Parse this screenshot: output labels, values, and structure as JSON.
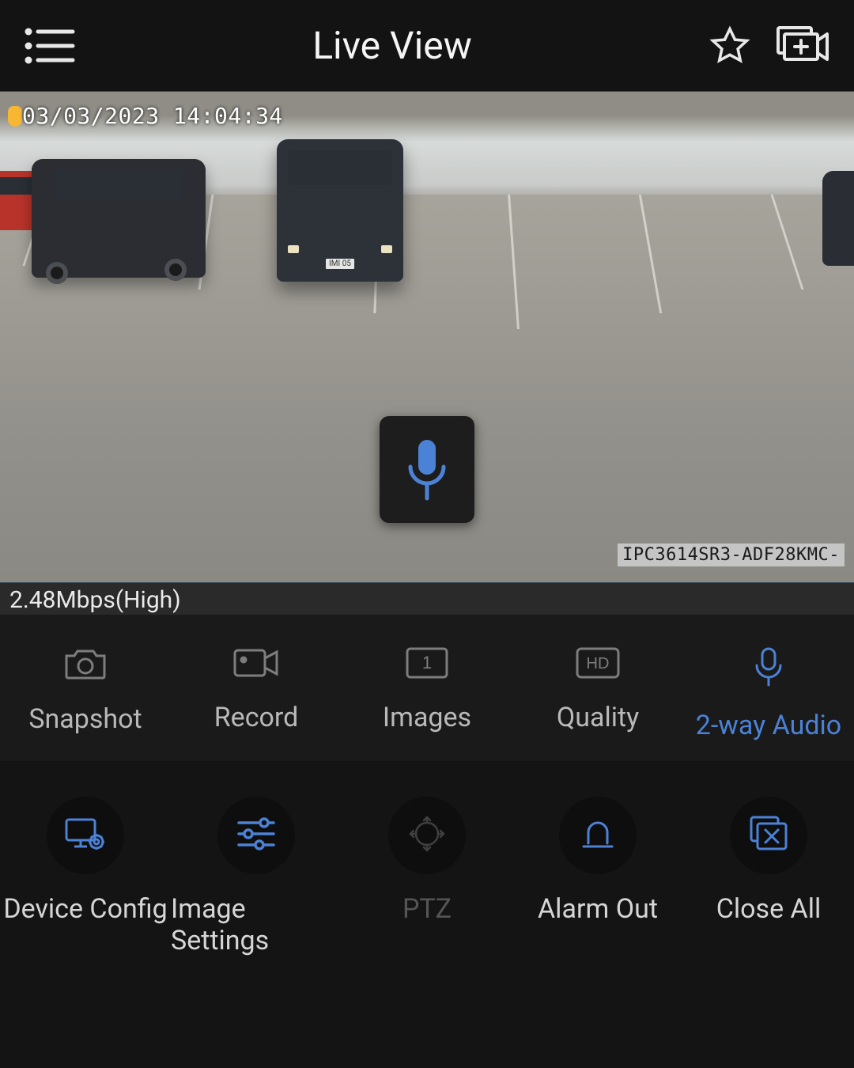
{
  "header": {
    "title": "Live View"
  },
  "video": {
    "timestamp": "03/03/2023 14:04:34",
    "model_overlay": "IPC3614SR3-ADF28KMC-",
    "bitrate_label": "2.48Mbps(High)"
  },
  "toolbar1": {
    "snapshot": "Snapshot",
    "record": "Record",
    "images": "Images",
    "images_count": "1",
    "quality": "Quality",
    "quality_badge": "HD",
    "two_way_audio": "2-way Audio"
  },
  "toolbar2": {
    "device_config": "Device Config",
    "image_settings": "Image Settings",
    "ptz": "PTZ",
    "alarm_out": "Alarm Out",
    "close_all": "Close All"
  },
  "colors": {
    "accent": "#4b82d6"
  }
}
